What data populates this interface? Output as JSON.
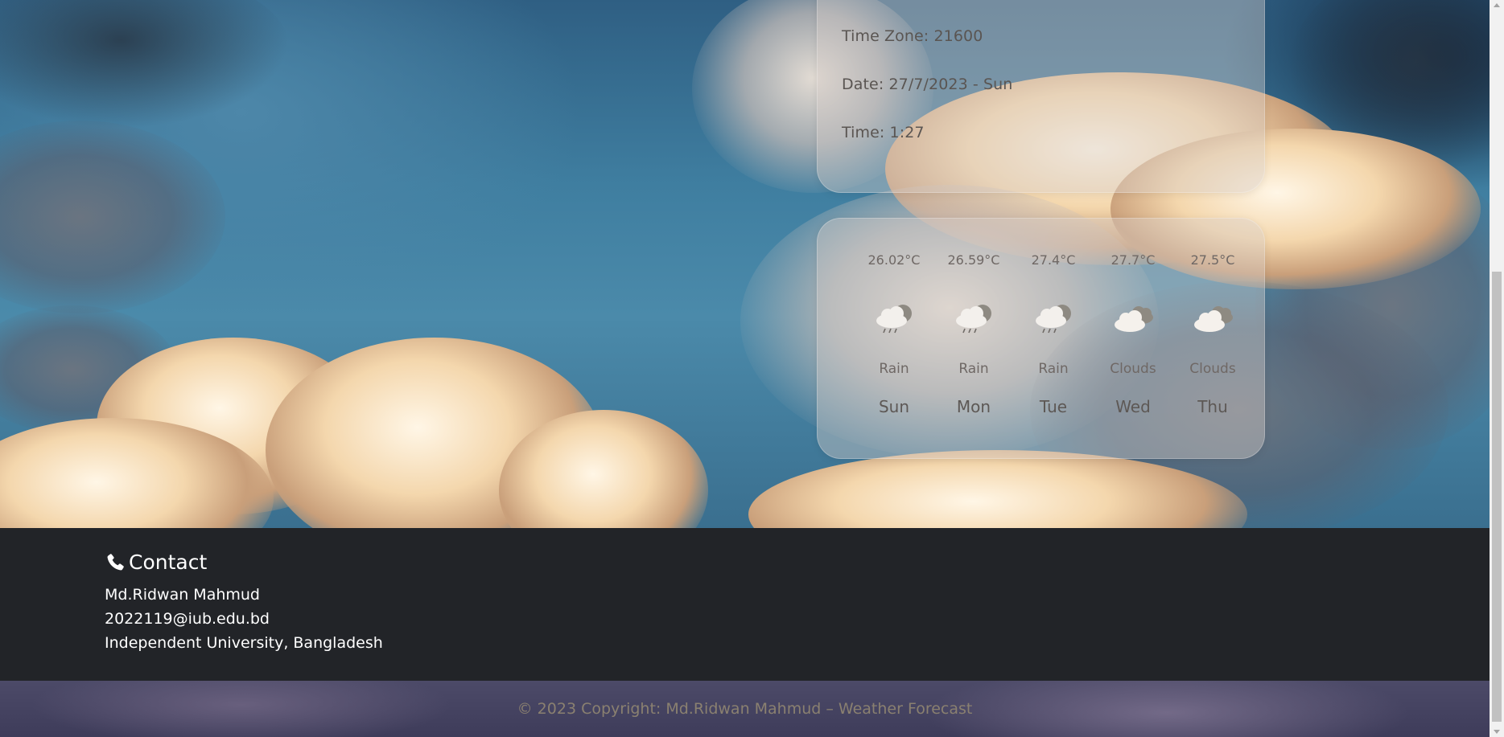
{
  "info_panel": {
    "time_zone": "Time Zone: 21600",
    "date": "Date: 27/7/2023 - Sun",
    "time": "Time: 1:27"
  },
  "forecast": [
    {
      "temp": "26.02°C",
      "condition": "Rain",
      "day": "Sun",
      "icon": "rain-cloud-icon"
    },
    {
      "temp": "26.59°C",
      "condition": "Rain",
      "day": "Mon",
      "icon": "rain-cloud-icon"
    },
    {
      "temp": "27.4°C",
      "condition": "Rain",
      "day": "Tue",
      "icon": "rain-cloud-icon"
    },
    {
      "temp": "27.7°C",
      "condition": "Clouds",
      "day": "Wed",
      "icon": "clouds-icon"
    },
    {
      "temp": "27.5°C",
      "condition": "Clouds",
      "day": "Thu",
      "icon": "clouds-icon"
    }
  ],
  "footer": {
    "contact_title": "Contact",
    "name": "Md.Ridwan Mahmud",
    "email": "2022119@iub.edu.bd",
    "institution": "Independent University, Bangladesh",
    "copyright": "© 2023 Copyright: Md.Ridwan Mahmud – Weather Forecast"
  },
  "colors": {
    "footer_bg": "#222428",
    "panel_bg": "rgba(215,205,200,0.42)",
    "copyright_text": "#8a8070"
  }
}
